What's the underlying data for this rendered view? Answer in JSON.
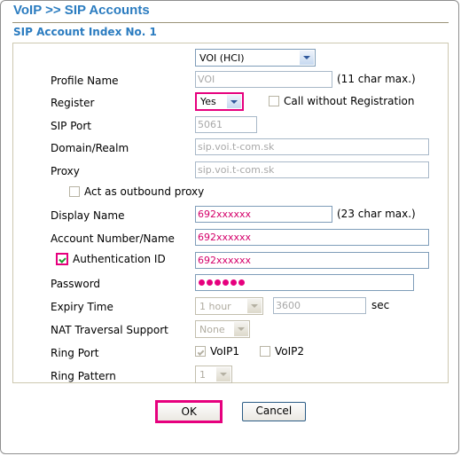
{
  "header": {
    "breadcrumb": "VoIP >> SIP Accounts",
    "section_title": "SIP Account Index No. 1",
    "title_color": "#2b7cc0"
  },
  "colors": {
    "accent_pink": "#e6007e",
    "value_pink": "#d4006a",
    "title_blue": "#2b7cc0",
    "panel_border": "#cdc8b0",
    "input_border": "#7f9db9",
    "check_green": "#1e9b2e"
  },
  "form": {
    "profile_select": {
      "value": "VOI (HCI)",
      "icon": "chevron-down-icon"
    },
    "profile_name": {
      "label": "Profile Name",
      "value": "VOI",
      "hint": "(11 char max.)"
    },
    "register": {
      "label": "Register",
      "value": "Yes",
      "highlighted": true,
      "icon": "chevron-down-icon"
    },
    "call_without_registration": {
      "label": "Call without Registration",
      "checked": false
    },
    "sip_port": {
      "label": "SIP Port",
      "value": "5061"
    },
    "domain_realm": {
      "label": "Domain/Realm",
      "value": "sip.voi.t-com.sk"
    },
    "proxy": {
      "label": "Proxy",
      "value": "sip.voi.t-com.sk"
    },
    "act_as_outbound_proxy": {
      "label": "Act as outbound proxy",
      "checked": false
    },
    "display_name": {
      "label": "Display Name",
      "value": "692xxxxxx",
      "hint": "(23 char max.)"
    },
    "account_number_name": {
      "label": "Account Number/Name",
      "value": "692xxxxxx"
    },
    "authentication_id": {
      "label": "Authentication ID",
      "value": "692xxxxxx",
      "checked": true,
      "highlighted": true
    },
    "password": {
      "label": "Password",
      "masked_length": 6
    },
    "expiry_time": {
      "label": "Expiry Time",
      "select_value": "1 hour",
      "seconds_value": "3600",
      "unit": "sec",
      "icon": "chevron-down-icon"
    },
    "nat_traversal_support": {
      "label": "NAT Traversal Support",
      "value": "None",
      "icon": "chevron-down-icon"
    },
    "ring_port": {
      "label": "Ring Port",
      "options": [
        {
          "label": "VoIP1",
          "checked": true
        },
        {
          "label": "VoIP2",
          "checked": false
        }
      ]
    },
    "ring_pattern": {
      "label": "Ring Pattern",
      "value": "1",
      "icon": "chevron-down-icon"
    }
  },
  "buttons": {
    "ok": "OK",
    "cancel": "Cancel"
  }
}
